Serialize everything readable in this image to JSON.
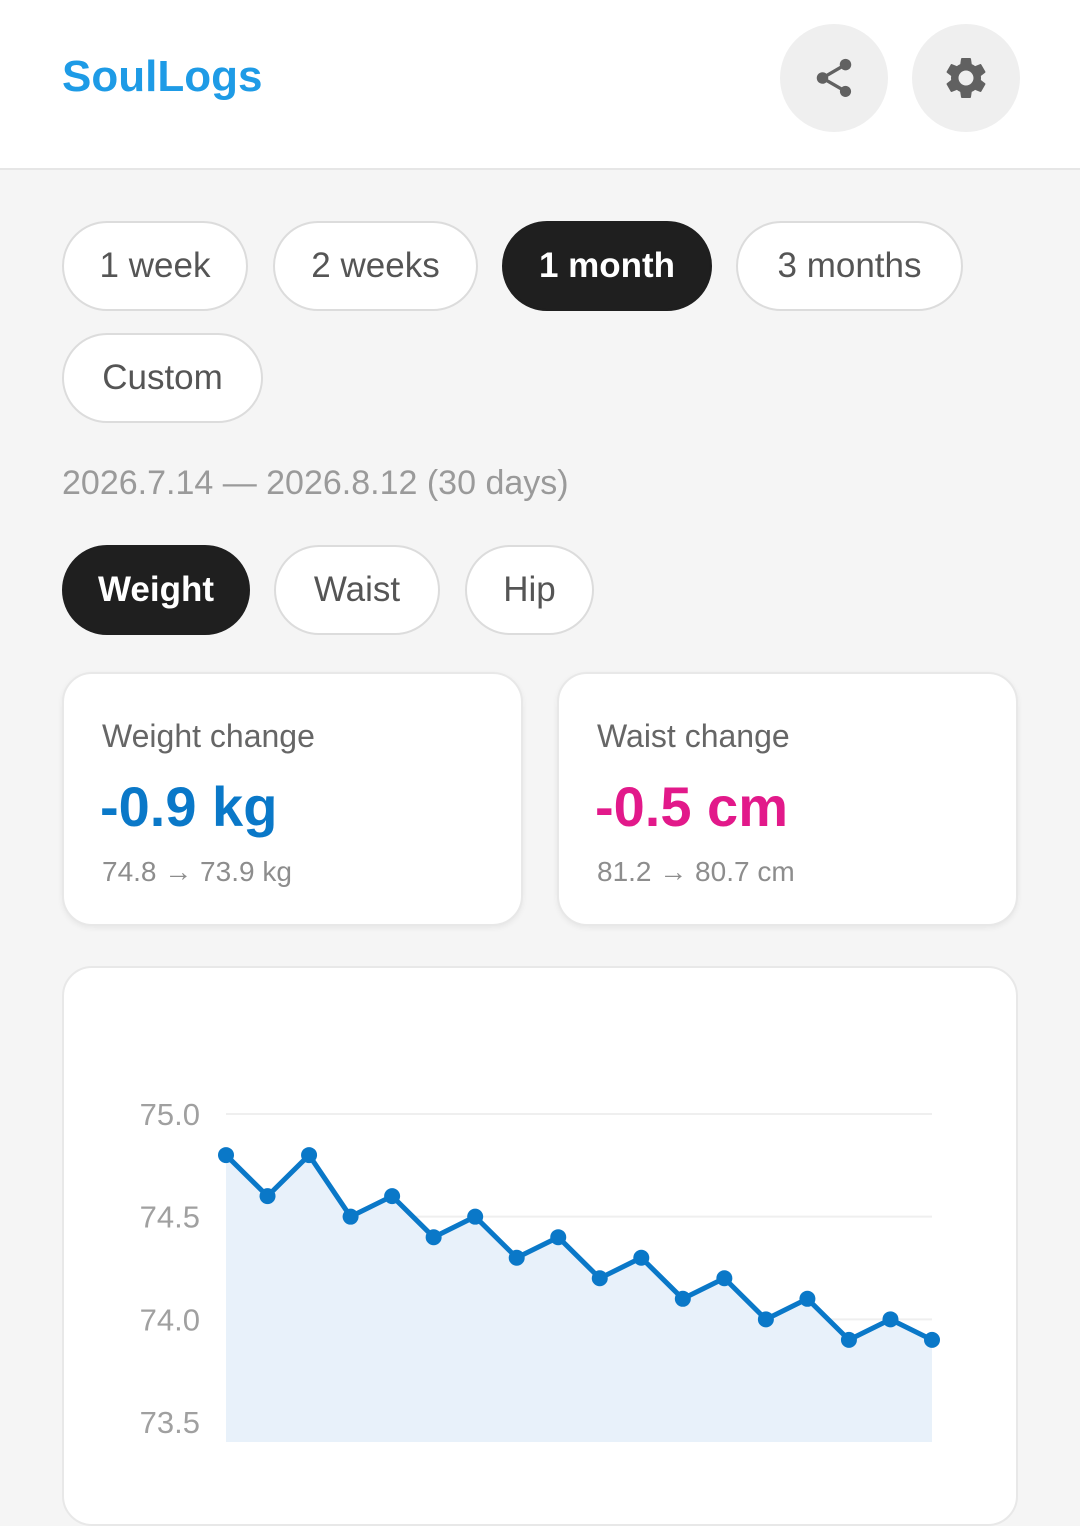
{
  "header": {
    "title": "SoulLogs",
    "share_icon": "share-icon",
    "settings_icon": "gear-icon"
  },
  "period_chips": [
    {
      "label": "1 week",
      "active": false
    },
    {
      "label": "2 weeks",
      "active": false
    },
    {
      "label": "1 month",
      "active": true
    },
    {
      "label": "3 months",
      "active": false
    },
    {
      "label": "Custom",
      "active": false
    }
  ],
  "date_range": "2026.7.14 — 2026.8.12 (30 days)",
  "metric_chips": [
    {
      "label": "Weight",
      "active": true
    },
    {
      "label": "Waist",
      "active": false
    },
    {
      "label": "Hip",
      "active": false
    }
  ],
  "summary": {
    "weight": {
      "label": "Weight change",
      "value": "-0.9 kg",
      "detail": "74.8 → 73.9 kg",
      "color": "#0a78c8"
    },
    "waist": {
      "label": "Waist change",
      "value": "-0.5 cm",
      "detail": "81.2 → 80.7 cm",
      "color": "#e2198a"
    }
  },
  "chart_data": {
    "type": "line",
    "yticks": [
      "75.0",
      "74.5",
      "74.0",
      "73.5"
    ],
    "ylim": [
      73.5,
      75.0
    ],
    "grid": true,
    "area_fill": true,
    "line_color": "#0a78c8",
    "fill_color": "#e8f1fa",
    "series": [
      {
        "values": [
          74.8,
          74.6,
          74.8,
          74.5,
          74.6,
          74.4,
          74.5,
          74.3,
          74.4,
          74.2,
          74.3,
          74.1,
          74.2,
          74.0,
          74.1,
          73.9,
          74.0,
          73.9
        ]
      }
    ]
  }
}
